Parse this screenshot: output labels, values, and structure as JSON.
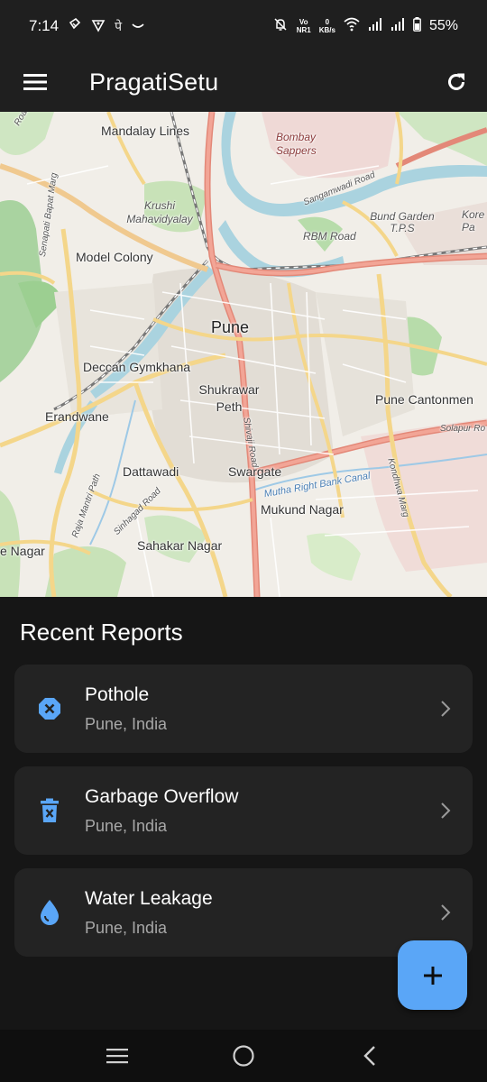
{
  "status_bar": {
    "time": "7:14",
    "network_top": "Vo",
    "network_bottom": "NR1",
    "speed_value": "0",
    "speed_unit": "KB/s",
    "battery": "55%",
    "left_glyph": "पे"
  },
  "app_bar": {
    "title": "PragatiSetu",
    "menu_icon": "hamburger-icon",
    "refresh_icon": "refresh-icon"
  },
  "map": {
    "labels": {
      "mandalay_lines": "Mandalay Lines",
      "bombay_sappers": "Bombay Sappers",
      "krushi": "Krushi Mahavidyalay",
      "model_colony": "Model Colony",
      "pune": "Pune",
      "deccan": "Deccan Gymkhana",
      "shukrawar": "Shukrawar Peth",
      "erandwane": "Erandwane",
      "pune_cantonment": "Pune Cantonmen",
      "dattawadi": "Dattawadi",
      "swargate": "Swargate",
      "mukund": "Mukund Nagar",
      "sahakar": "Sahakar Nagar",
      "e_nagar": "e Nagar",
      "rbm_road": "RBM Road",
      "bund_garden": "Bund Garden T.P.S",
      "sangamwadi": "Sangamwadi Road",
      "solapur": "Solapur Ro",
      "mutha_canal": "Mutha Right Bank Canal",
      "senapati": "Senapati Bapat Marg",
      "shivaji": "Shivaji Road",
      "sinhagad": "Sinhagad Road",
      "raja": "Raja Mantri Path",
      "kondhwa": "Kondhwa Marg",
      "kore": "Kore Pa",
      "road_nw": "Road"
    }
  },
  "recent": {
    "title": "Recent Reports",
    "items": [
      {
        "title": "Pothole",
        "subtitle": "Pune, India",
        "icon": "cancel-circle-icon"
      },
      {
        "title": "Garbage Overflow",
        "subtitle": "Pune, India",
        "icon": "trash-icon"
      },
      {
        "title": "Water Leakage",
        "subtitle": "Pune, India",
        "icon": "water-drop-icon"
      }
    ]
  },
  "fab": {
    "icon": "add-icon",
    "label": "+"
  },
  "colors": {
    "accent": "#5aa6f7",
    "background": "#161616",
    "card": "#232323",
    "bar": "#1f1f1f"
  },
  "nav_bar": {
    "recents": "recents-icon",
    "home": "home-icon",
    "back": "back-icon"
  }
}
